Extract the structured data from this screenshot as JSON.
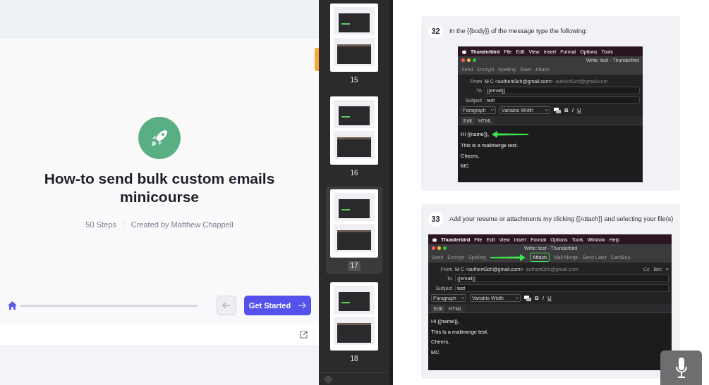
{
  "course": {
    "title": "How-to send bulk custom emails minicourse",
    "steps": "50 Steps",
    "author": "Created by Matthew Chappell",
    "progress": {
      "level": 0
    },
    "start_button": "Get Started"
  },
  "thumbnails": [
    {
      "page": "15",
      "selected": false
    },
    {
      "page": "16",
      "selected": false
    },
    {
      "page": "17",
      "selected": true
    },
    {
      "page": "18",
      "selected": false
    }
  ],
  "steps": [
    {
      "number": "32",
      "text": "In the {{body}} of the message type the following:",
      "screenshot": {
        "menu": [
          "Thunderbird",
          "File",
          "Edit",
          "View",
          "Insert",
          "Format",
          "Options",
          "Tools"
        ],
        "window_title": "Write: test - Thunderbird",
        "toolbar": [
          {
            "label": "Send",
            "pointed": false
          },
          {
            "label": "Encrypt",
            "pointed": false
          },
          {
            "label": "Spelling",
            "pointed": false
          },
          {
            "label": "Save",
            "pointed": false
          },
          {
            "label": "Attach",
            "pointed": false
          }
        ],
        "from_label": "From",
        "from": "M C <authent3ch@gmail.com>",
        "from_hint": "authent3ch@gmail.com",
        "fields": [
          {
            "label": "To",
            "value": "{{email}}"
          },
          {
            "label": "Subject",
            "value": "test"
          }
        ],
        "format": [
          "Paragraph",
          "Variable Width"
        ],
        "format_buttons": [
          "B",
          "I",
          "U"
        ],
        "editor_tabs": [
          "Edit",
          "HTML"
        ],
        "body": [
          {
            "text": "Hi {{name}},",
            "pointed": true
          },
          {
            "text": "This is a mailmerge test.",
            "pointed": false
          },
          {
            "text": "Cheers,",
            "pointed": false
          },
          {
            "text": "MC",
            "pointed": false
          }
        ]
      }
    },
    {
      "number": "33",
      "text": "Add your resume or attachments my clicking {{Attach}} and selecting your file(s)",
      "screenshot": {
        "menu": [
          "Thunderbird",
          "File",
          "Edit",
          "View",
          "Insert",
          "Format",
          "Options",
          "Tools",
          "Window",
          "Help"
        ],
        "window_title": "Write: test - Thunderbird",
        "toolbar": [
          {
            "label": "Send",
            "pointed": false
          },
          {
            "label": "Encrypt",
            "pointed": false
          },
          {
            "label": "Spelling",
            "pointed": false
          },
          {
            "label": "Attach",
            "pointed": true
          },
          {
            "label": "Mail Merge",
            "pointed": false
          },
          {
            "label": "Send Later",
            "pointed": false
          },
          {
            "label": "CardBoo",
            "pointed": false
          }
        ],
        "from_label": "From",
        "from": "M C <authent3ch@gmail.com>",
        "from_hint": "authent3ch@gmail.com",
        "header_extras": [
          "Cc",
          "Bcc",
          "»"
        ],
        "fields": [
          {
            "label": "To",
            "value": "{{email}}"
          },
          {
            "label": "Subject",
            "value": "test"
          }
        ],
        "format": [
          "Paragraph",
          "Variable Width"
        ],
        "format_buttons": [
          "B",
          "I",
          "U"
        ],
        "editor_tabs": [
          "Edit",
          "HTML"
        ],
        "body": [
          {
            "text": "Hi {{name}},",
            "pointed": false
          },
          {
            "text": "This is a mailmerge test.",
            "pointed": false
          },
          {
            "text": "Cheers,",
            "pointed": false
          },
          {
            "text": "MC",
            "pointed": false
          }
        ]
      }
    }
  ]
}
